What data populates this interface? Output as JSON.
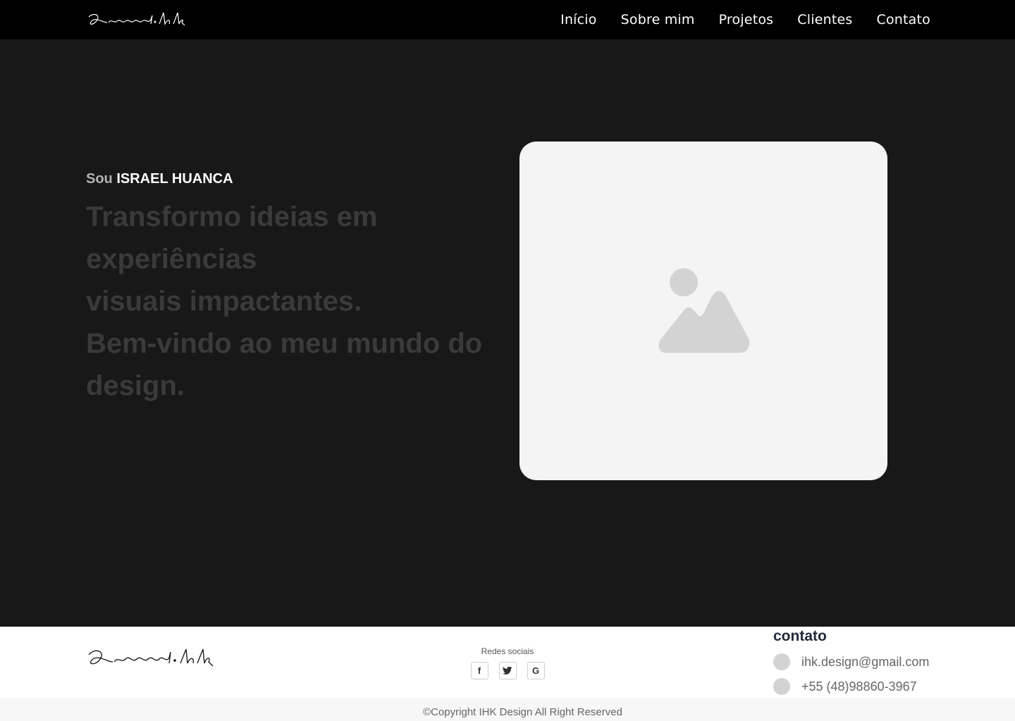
{
  "navbar": {
    "logo_text": "Israel.hk",
    "links": [
      "Início",
      "Sobre mim",
      "Projetos",
      "Clientes",
      "Contato"
    ]
  },
  "hero": {
    "intro_prefix": "Sou",
    "intro_name": "ISRAEL HUANCA",
    "headline_lines": [
      "Transformo ideias em",
      "experiências",
      "visuais impactantes.",
      "Bem-vindo ao meu mundo do",
      "design."
    ],
    "image_icon": "image-placeholder-icon"
  },
  "footer": {
    "logo_text": "Israel.hk",
    "social_title": "Redes sociais",
    "social_icons": [
      {
        "name": "facebook-icon",
        "glyph": "f"
      },
      {
        "name": "twitter-icon",
        "glyph": "t"
      },
      {
        "name": "google-icon",
        "glyph": "G"
      }
    ],
    "contact_title": "contato",
    "contact_email": "ihk.design@gmail.com",
    "contact_phone": "+55 (48)98860-3967",
    "copyright": "©Copyright IHK Design All Right Reserved"
  },
  "colors": {
    "navbar_bg": "#000000",
    "hero_bg": "#181818",
    "headline": "#3a3a3a",
    "card_bg": "#f4f4f4",
    "icon_gray": "#d3d3d3"
  }
}
